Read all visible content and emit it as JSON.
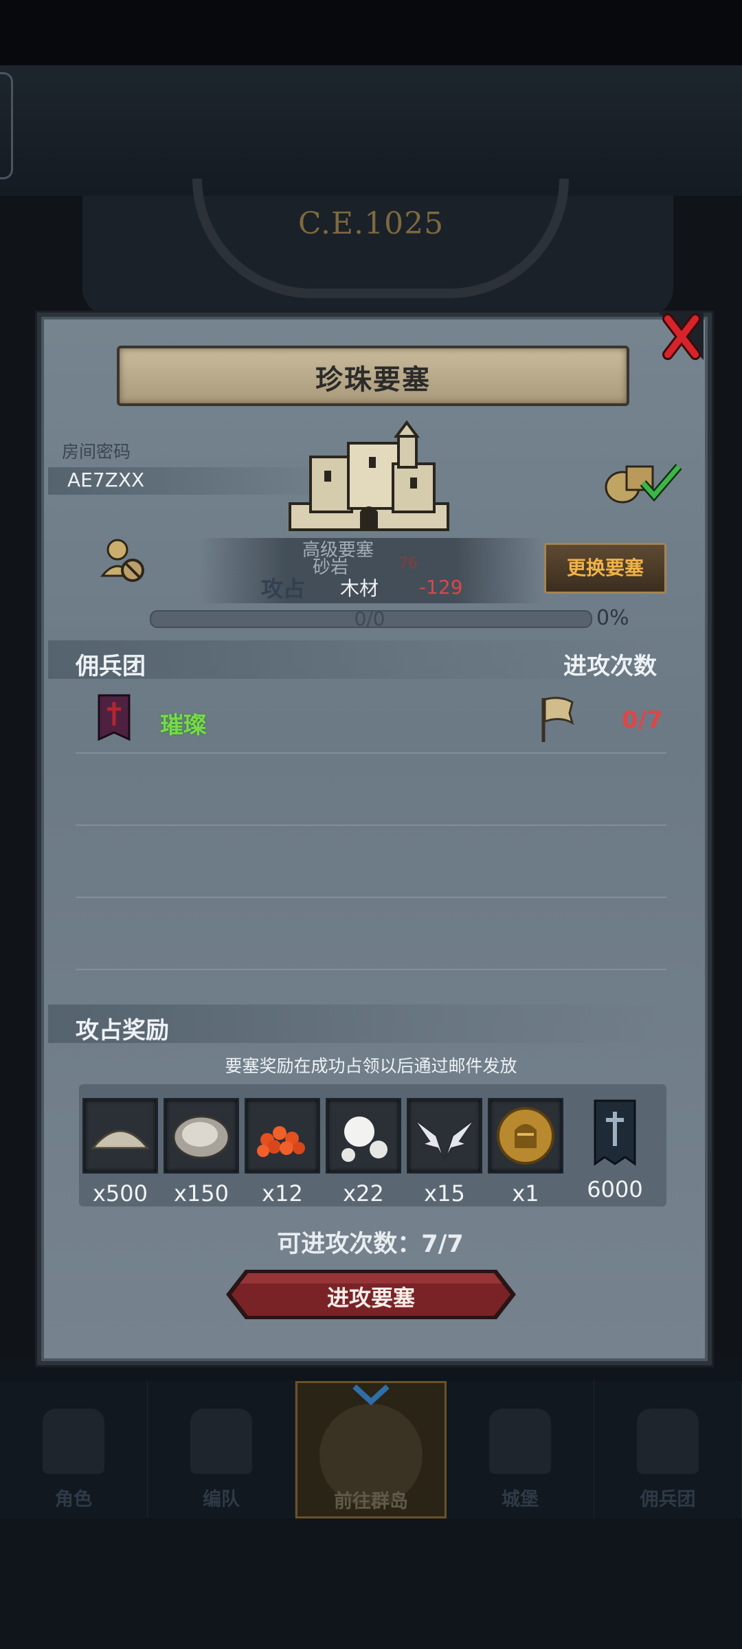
{
  "background": {
    "year": "C.E.1025"
  },
  "dialog": {
    "title": "珍珠要塞",
    "room_password_label": "房间密码",
    "room_password_value": "AE7ZXX",
    "fortress_level": "高级要塞",
    "resource1_label": "砂岩",
    "resource1_value": "76",
    "occupy_label": "攻占",
    "resource2_label": "木材",
    "resource2_value": "-129",
    "change_button": "更换要塞",
    "progress_text": "0/0",
    "progress_percent": "0%",
    "progress_value": 0
  },
  "mercenary": {
    "section_title": "佣兵团",
    "attack_count_label": "进攻次数",
    "rows": [
      {
        "name": "璀璨",
        "count": "0/7"
      }
    ]
  },
  "rewards": {
    "section_title": "攻占奖励",
    "note": "要塞奖励在成功占领以后通过邮件发放",
    "items": [
      {
        "icon": "sand-pile-icon",
        "qty": "x500"
      },
      {
        "icon": "oyster-icon",
        "qty": "x150"
      },
      {
        "icon": "fish-roe-icon",
        "qty": "x12"
      },
      {
        "icon": "pearl-icon",
        "qty": "x22"
      },
      {
        "icon": "wings-emblem-icon",
        "qty": "x15"
      },
      {
        "icon": "knight-medal-icon",
        "qty": "x1"
      },
      {
        "icon": "guild-banner-icon",
        "qty": "6000"
      }
    ],
    "attacks_remaining": "可进攻次数：7/7",
    "attack_button": "进攻要塞"
  },
  "nav": {
    "items": [
      {
        "label": "角色"
      },
      {
        "label": "编队"
      },
      {
        "label": "前往群岛"
      },
      {
        "label": "城堡"
      },
      {
        "label": "佣兵团"
      }
    ],
    "active_index": 2
  },
  "colors": {
    "accent_orange": "#f1b348",
    "mercenary_name_green": "#7ad946",
    "count_red": "#e04545",
    "attack_button_red": "#7a2327"
  }
}
